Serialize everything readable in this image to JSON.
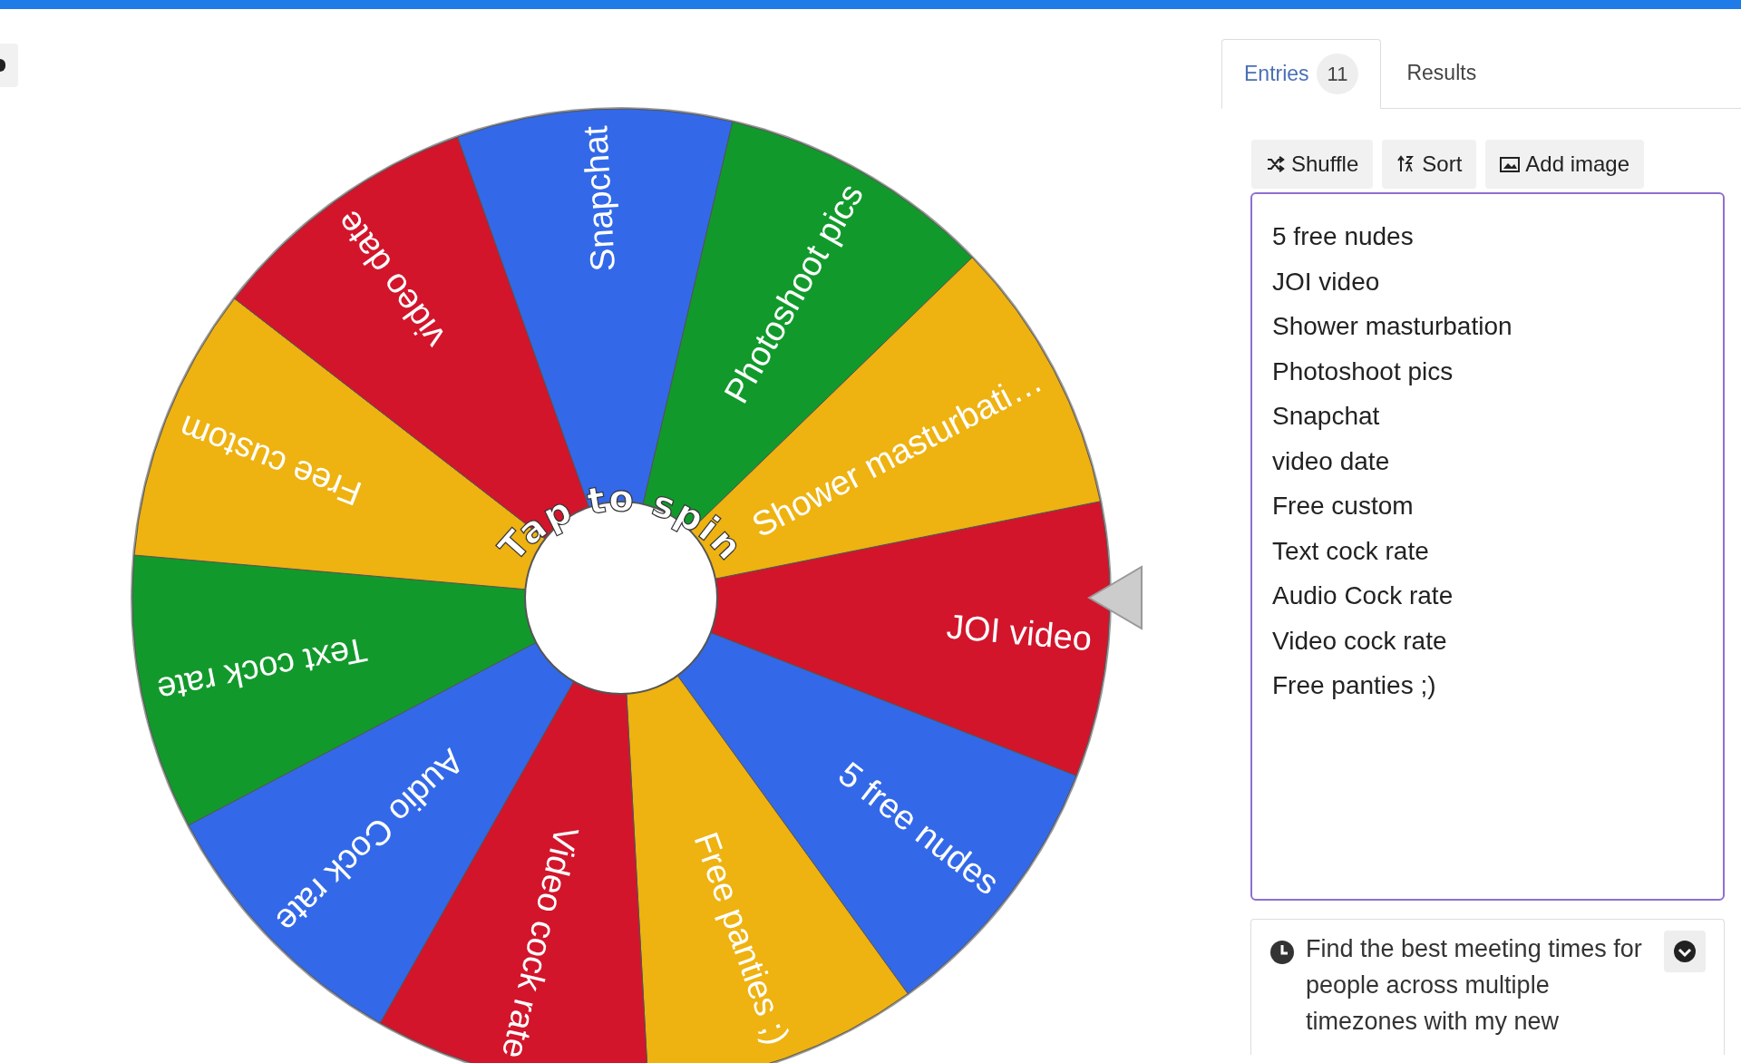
{
  "wheel": {
    "center_text": "Tap to spin",
    "segments": [
      {
        "label": "JOI video",
        "color": "#d2152b"
      },
      {
        "label": "5 free nudes",
        "color": "#3369e8"
      },
      {
        "label": "Free panties ;)",
        "color": "#eeb211"
      },
      {
        "label": "Video cock rate",
        "color": "#d2152b"
      },
      {
        "label": "Audio Cock rate",
        "color": "#3369e8"
      },
      {
        "label": "Text cock rate",
        "color": "#119a2b"
      },
      {
        "label": "Free custom",
        "color": "#eeb211"
      },
      {
        "label": "video date",
        "color": "#d2152b"
      },
      {
        "label": "Snapchat",
        "color": "#3369e8"
      },
      {
        "label": "Photoshoot pics",
        "color": "#119a2b"
      },
      {
        "label": "Shower masturbati…",
        "color": "#eeb211"
      }
    ]
  },
  "tabs": [
    {
      "label": "Entries",
      "count": "11",
      "selected": true
    },
    {
      "label": "Results",
      "selected": false
    }
  ],
  "toolbar": [
    {
      "kind": "shuffle",
      "label": "Shuffle"
    },
    {
      "kind": "sort",
      "label": "Sort"
    },
    {
      "kind": "image",
      "label": "Add image"
    }
  ],
  "entries": [
    "5 free nudes",
    "JOI video",
    "Shower masturbation",
    "Photoshoot pics",
    "Snapchat",
    "video date",
    "Free custom",
    "Text cock rate",
    "Audio Cock rate",
    "Video cock rate",
    "Free panties ;)"
  ],
  "promo": {
    "text": "Find the best meeting times for people across multiple timezones with my new"
  }
}
